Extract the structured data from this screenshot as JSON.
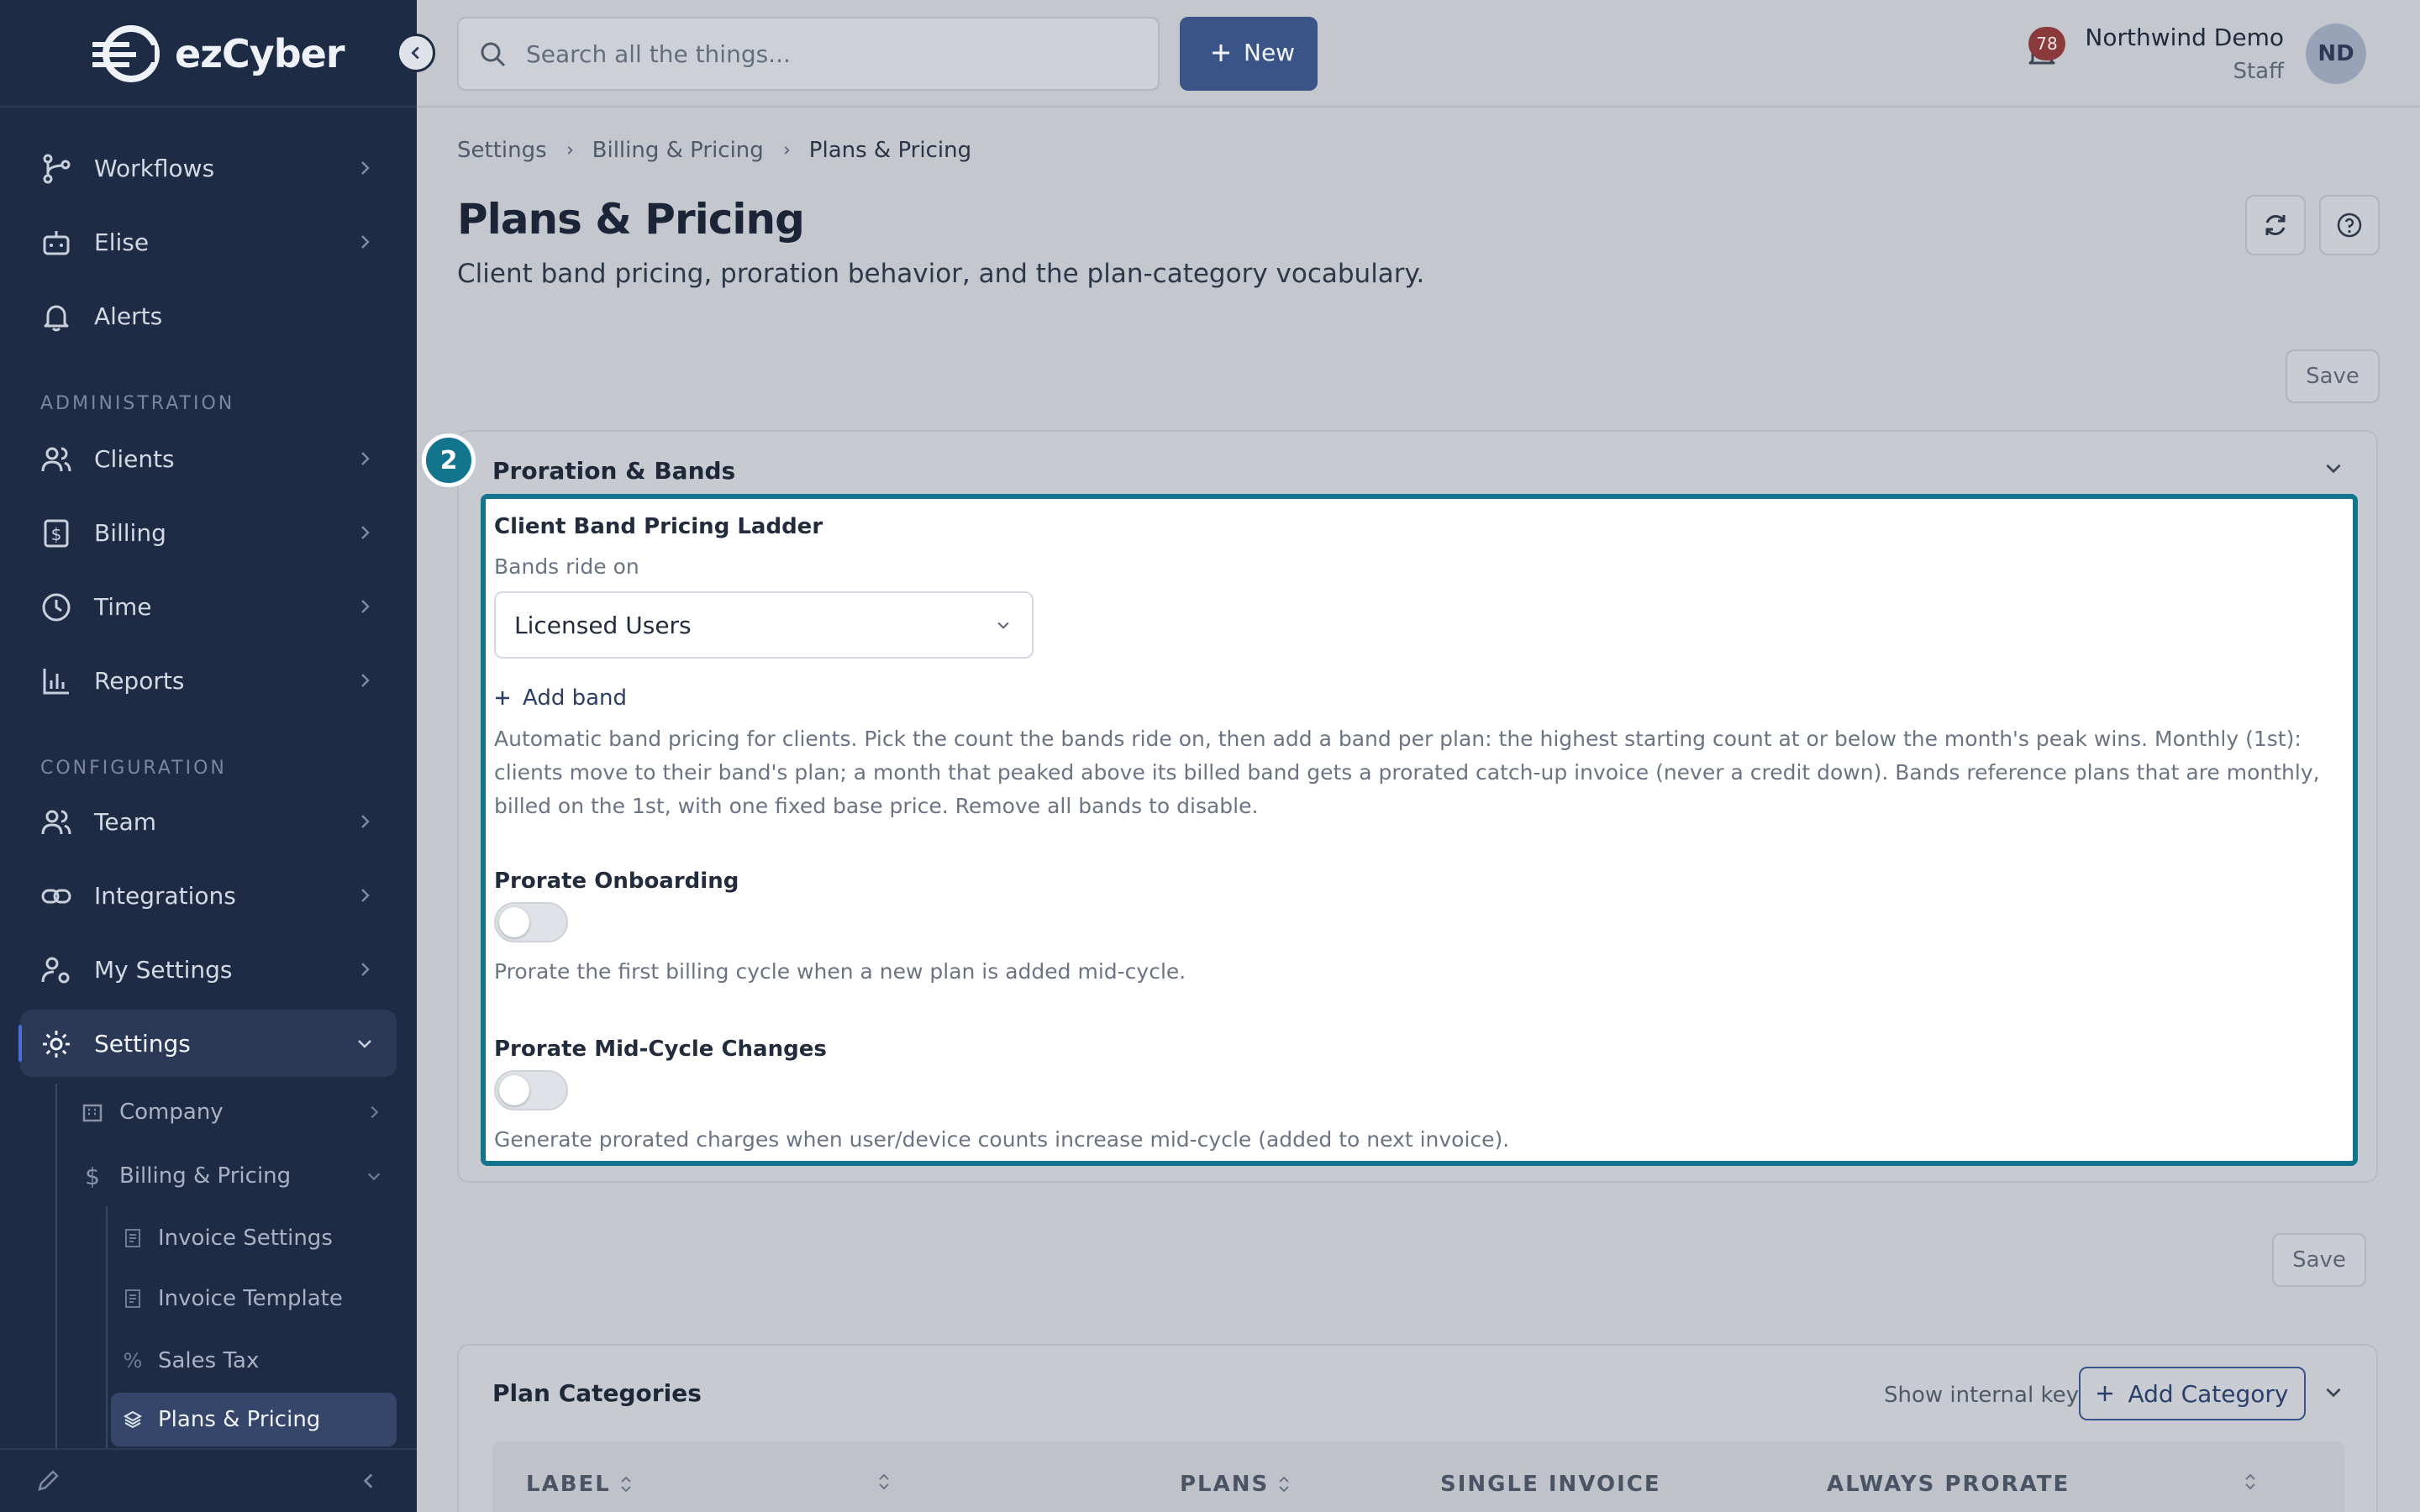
{
  "brand": {
    "logo_text": "ezCyber"
  },
  "sidebar": {
    "nav": [
      {
        "label": "Workflows"
      },
      {
        "label": "Elise"
      },
      {
        "label": "Alerts"
      }
    ],
    "section_admin": "ADMINISTRATION",
    "admin": [
      {
        "label": "Clients"
      },
      {
        "label": "Billing"
      },
      {
        "label": "Time"
      },
      {
        "label": "Reports"
      }
    ],
    "section_config": "CONFIGURATION",
    "config": [
      {
        "label": "Team"
      },
      {
        "label": "Integrations"
      },
      {
        "label": "My Settings"
      },
      {
        "label": "Settings"
      }
    ],
    "settings_sub": [
      {
        "label": "Company"
      },
      {
        "label": "Billing & Pricing"
      }
    ],
    "billing_sub": [
      {
        "label": "Invoice Settings"
      },
      {
        "label": "Invoice Template"
      },
      {
        "label": "Sales Tax"
      },
      {
        "label": "Plans & Pricing"
      }
    ]
  },
  "topbar": {
    "search_placeholder": "Search all the things...",
    "new_label": "New",
    "notification_count": "78",
    "user_name": "Northwind Demo",
    "user_role": "Staff",
    "avatar_initials": "ND"
  },
  "breadcrumb": [
    "Settings",
    "Billing & Pricing",
    "Plans & Pricing"
  ],
  "page": {
    "title": "Plans & Pricing",
    "subtitle": "Client band pricing, proration behavior, and the plan-category vocabulary.",
    "save_label": "Save"
  },
  "proration": {
    "step": "2",
    "title": "Proration & Bands",
    "ladder_title": "Client Band Pricing Ladder",
    "bands_ride_on_label": "Bands ride on",
    "bands_ride_on_value": "Licensed Users",
    "add_band_label": "Add band",
    "description": "Automatic band pricing for clients. Pick the count the bands ride on, then add a band per plan: the highest starting count at or below the month's peak wins. Monthly (1st): clients move to their band's plan; a month that peaked above its billed band gets a prorated catch-up invoice (never a credit down). Bands reference plans that are monthly, billed on the 1st, with one fixed base price. Remove all bands to disable.",
    "prorate_onboarding_title": "Prorate Onboarding",
    "prorate_onboarding_on": false,
    "prorate_onboarding_help": "Prorate the first billing cycle when a new plan is added mid-cycle.",
    "prorate_midcycle_title": "Prorate Mid-Cycle Changes",
    "prorate_midcycle_on": false,
    "prorate_midcycle_help": "Generate prorated charges when user/device counts increase mid-cycle (added to next invoice)."
  },
  "categories": {
    "title": "Plan Categories",
    "show_keys_label": "Show internal keys",
    "add_label": "Add Category",
    "columns": [
      "LABEL",
      "PLANS",
      "SINGLE INVOICE",
      "ALWAYS PRORATE"
    ]
  },
  "colors": {
    "sidebar_bg": "#1e2b45",
    "accent": "#3a5488",
    "highlight": "#13748e"
  }
}
